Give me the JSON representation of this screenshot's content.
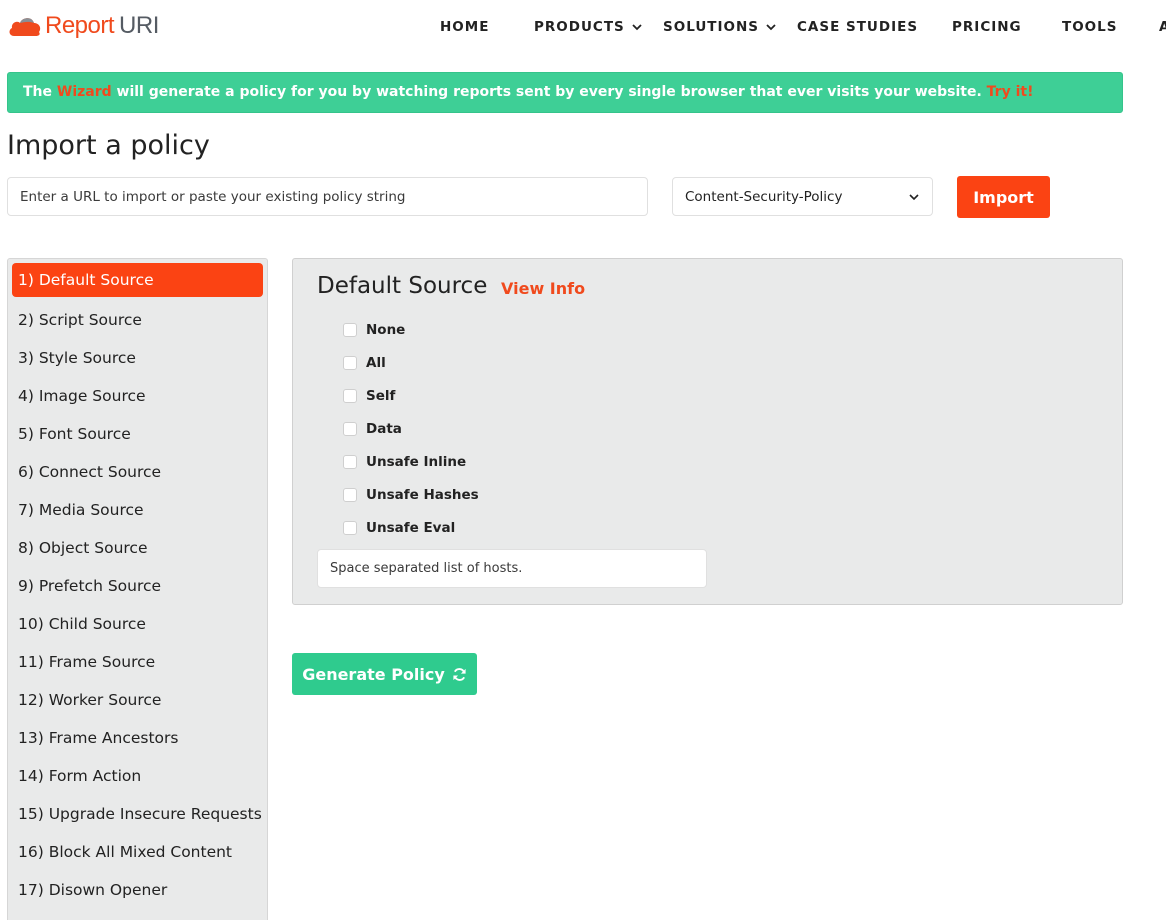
{
  "logo": {
    "report": "Report",
    "uri": "URI",
    "brand_color": "#f04a1d",
    "icon": "cloud-icon"
  },
  "nav": {
    "items": [
      {
        "label": "HOME"
      },
      {
        "label": "PRODUCTS",
        "dropdown": true
      },
      {
        "label": "SOLUTIONS",
        "dropdown": true
      },
      {
        "label": "CASE STUDIES"
      },
      {
        "label": "PRICING"
      },
      {
        "label": "TOOLS"
      },
      {
        "label": "A"
      }
    ]
  },
  "banner": {
    "prefix": "The ",
    "wizard_link": "Wizard",
    "message": " will generate a policy for you by watching reports sent by every single browser that ever visits your website. ",
    "try_link": "Try it!",
    "bg_color": "#3ecf96"
  },
  "import": {
    "title": "Import a policy",
    "url_placeholder": "Enter a URL to import or paste your existing policy string",
    "select_value": "Content-Security-Policy",
    "button_label": "Import",
    "button_color": "#fb4313"
  },
  "sidebar": {
    "items": [
      {
        "label": "1) Default Source",
        "active": true
      },
      {
        "label": "2) Script Source"
      },
      {
        "label": "3) Style Source"
      },
      {
        "label": "4) Image Source"
      },
      {
        "label": "5) Font Source"
      },
      {
        "label": "6) Connect Source"
      },
      {
        "label": "7) Media Source"
      },
      {
        "label": "8) Object Source"
      },
      {
        "label": "9) Prefetch Source"
      },
      {
        "label": "10) Child Source"
      },
      {
        "label": "11) Frame Source"
      },
      {
        "label": "12) Worker Source"
      },
      {
        "label": "13) Frame Ancestors"
      },
      {
        "label": "14) Form Action"
      },
      {
        "label": "15) Upgrade Insecure Requests"
      },
      {
        "label": "16) Block All Mixed Content"
      },
      {
        "label": "17) Disown Opener"
      }
    ]
  },
  "panel": {
    "title": "Default Source",
    "view_info": "View Info",
    "options": [
      {
        "label": "None",
        "checked": false
      },
      {
        "label": "All",
        "checked": false
      },
      {
        "label": "Self",
        "checked": false
      },
      {
        "label": "Data",
        "checked": false
      },
      {
        "label": "Unsafe Inline",
        "checked": false
      },
      {
        "label": "Unsafe Hashes",
        "checked": false
      },
      {
        "label": "Unsafe Eval",
        "checked": false
      }
    ],
    "hosts_placeholder": "Space separated list of hosts."
  },
  "generate": {
    "label": "Generate Policy",
    "icon": "refresh-icon",
    "color": "#2fcb8e"
  }
}
